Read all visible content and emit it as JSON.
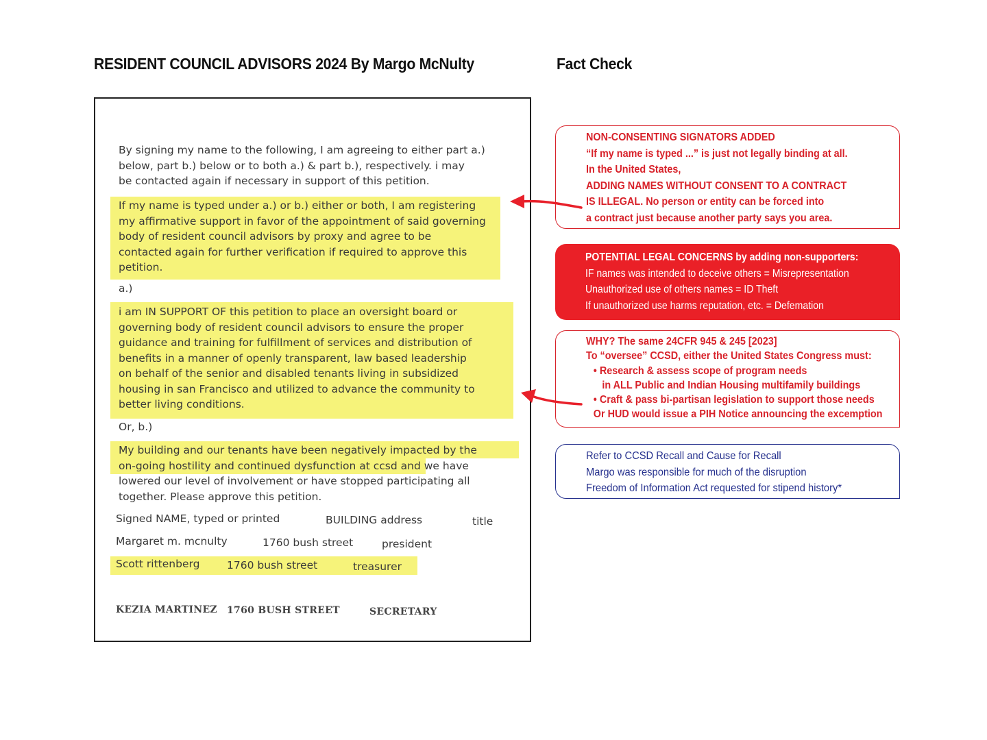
{
  "header": {
    "doc_title": "RESIDENT COUNCIL ADVISORS 2024 By Margo McNulty",
    "fact_title": "Fact Check"
  },
  "petition": {
    "intro": [
      "By signing my name to the following, I am agreeing to either part a.)",
      "below, part b.) below or to both a.) & part  b.), respectively. i may",
      "be contacted again if necessary in support of this petition."
    ],
    "proxy": [
      "If my name is typed under a.) or b.) either or both, I am registering",
      "my affirmative support in favor of the appointment of said governing",
      "body of resident council advisors by proxy and agree to be",
      "contacted again for further verification if required to approve this",
      "petition."
    ],
    "part_a_label": "a.)",
    "part_a": [
      " i am IN SUPPORT OF this petition to place an oversight board or",
      "governing body of resident council advisors to ensure the proper",
      "guidance and training for fulfillment of services and distribution of",
      "benefits  in a manner of openly transparent, law based leadership",
      "on  behalf of the senior and disabled tenants living in subsidized",
      "housing in san Francisco and utilized  to advance the community to",
      "better living conditions."
    ],
    "part_b_label": "Or, b.)",
    "part_b": [
      "My building and our tenants have been negatively impacted by the",
      "on-going hostility and continued dysfunction at ccsd and we have",
      "lowered our level of involvement or have stopped participating all",
      "together. Please approve this petition."
    ],
    "sig_header": {
      "name": "Signed  NAME, typed or printed",
      "address": "BUILDING address",
      "title": "title"
    },
    "signers": [
      {
        "name": "Margaret m. mcnulty",
        "address": "1760 bush street",
        "title": "president"
      },
      {
        "name": "Scott rittenberg",
        "address": "1760 bush street",
        "title": "treasurer"
      }
    ],
    "typed_signer": {
      "name": "KEZIA MARTINEZ",
      "address": "1760 BUSH STREET",
      "title": "SECRETARY"
    }
  },
  "fact_check": {
    "consent": [
      "NON-CONSENTING SIGNATORS ADDED",
      "“If my name is typed ...” is just not legally binding at all.",
      "In the United States,",
      "ADDING NAMES WITHOUT CONSENT TO A CONTRACT",
      "IS ILLEGAL. No person or entity can be forced into",
      "a contract just because another party says you area."
    ],
    "legal": {
      "heading": "POTENTIAL LEGAL CONCERNS by adding non-supporters:",
      "lines": [
        "IF names was intended to deceive others = Misrepresentation",
        "Unauthorized use of others names = ID Theft",
        "If unauthorized use harms reputation, etc. = Defemation"
      ]
    },
    "why": {
      "line1": "WHY? The same 24CFR 945 & 245 [2023]",
      "line2": "To “oversee” CCSD, either the United States Congress must:",
      "bullet1": "•  Research & assess scope of program needs",
      "bullet1_cont": "in ALL Public and Indian Housing multifamily buildings",
      "bullet2": "•  Craft & pass bi-partisan legislation to support those needs",
      "line_or": "Or HUD would issue a PIH Notice announcing the excemption"
    },
    "recall": [
      "Refer to CCSD Recall and Cause for Recall",
      "Margo was responsible for much of the disruption",
      "Freedom of Information Act requested for stipend history*"
    ]
  },
  "colors": {
    "red": "#ea2027",
    "blue": "#25308d",
    "highlight": "#f6f37a"
  }
}
